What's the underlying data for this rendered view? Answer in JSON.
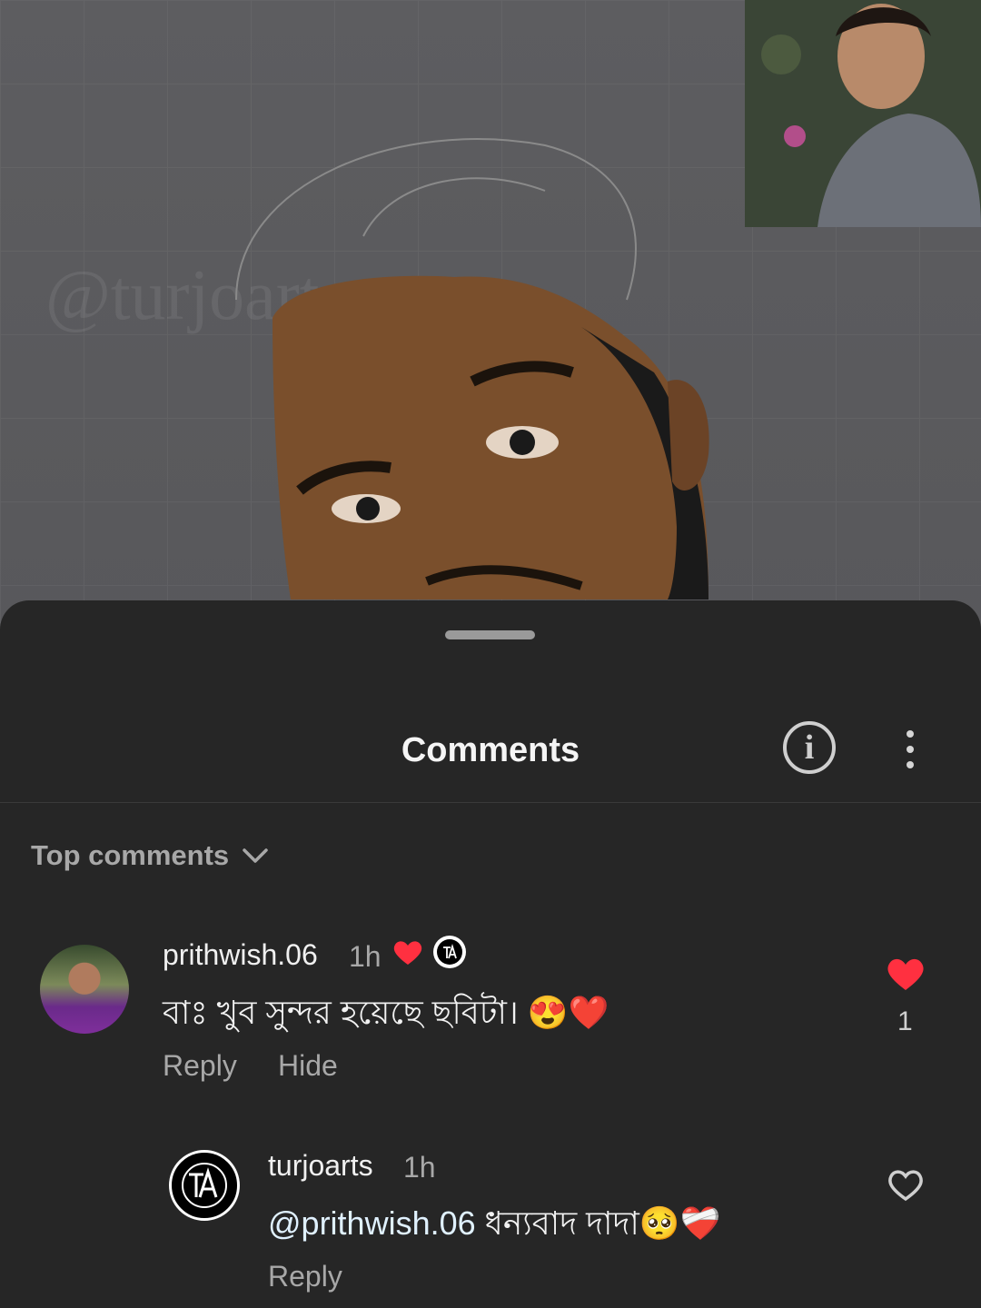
{
  "background": {
    "watermark": "@turjoarts"
  },
  "sheet": {
    "title": "Comments",
    "sort_label": "Top comments"
  },
  "comments": [
    {
      "username": "prithwish.06",
      "time": "1h",
      "text": "বাঃ খুব সুন্দর হয়েছে ছবিটা। 😍❤️",
      "actions": [
        "Reply",
        "Hide"
      ],
      "like_count": "1",
      "liked": true
    },
    {
      "username": "turjoarts",
      "time": "1h",
      "mention": "@prithwish.06",
      "text": " ধন্যবাদ দাদা🥺❤️‍🩹",
      "actions": [
        "Reply"
      ],
      "liked": false
    }
  ],
  "colors": {
    "like_red": "#ff3040",
    "sheet_bg": "#262626"
  }
}
